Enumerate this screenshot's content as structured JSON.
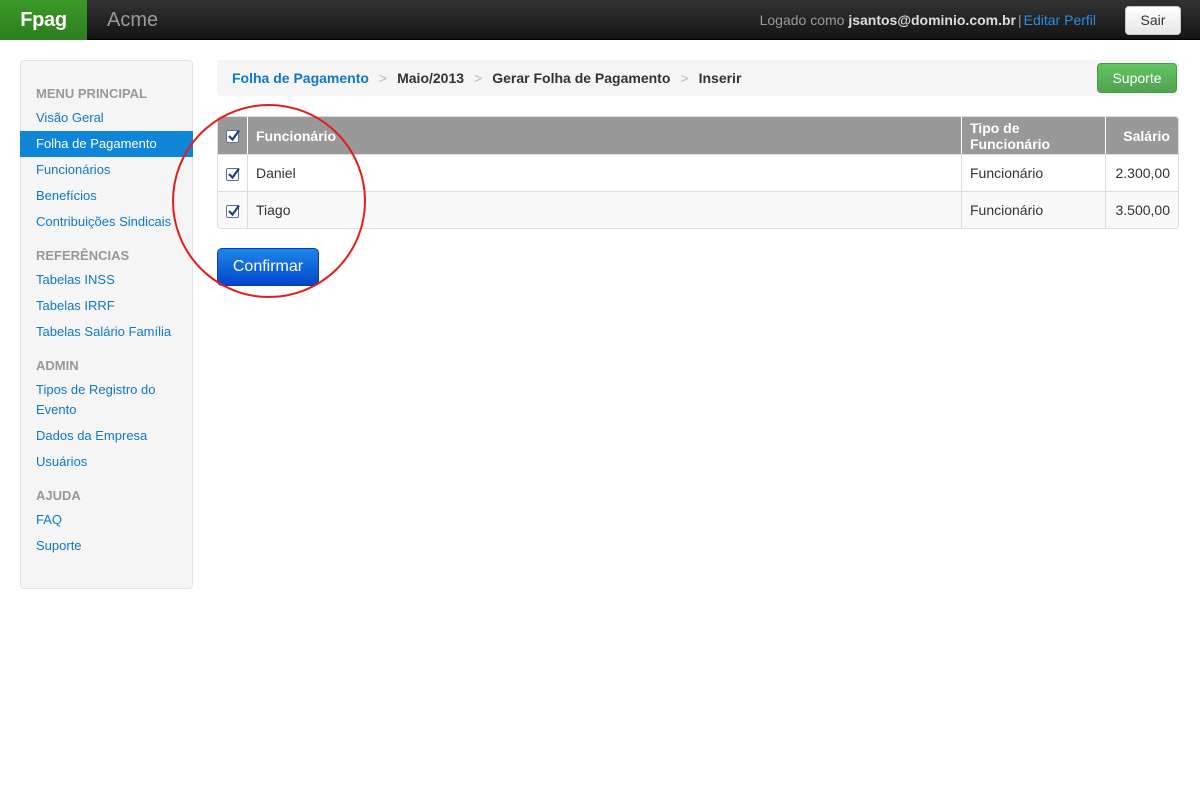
{
  "navbar": {
    "brand": "Fpag",
    "company": "Acme",
    "logged_prefix": "Logado como",
    "user_email": "jsantos@dominio.com.br",
    "separator": "|",
    "edit_profile": "Editar Perfil",
    "logout": "Sair"
  },
  "sidebar": {
    "sections": [
      {
        "header": "MENU PRINCIPAL",
        "items": [
          "Visão Geral",
          "Folha de Pagamento",
          "Funcionários",
          "Benefícios",
          "Contribuições Sindicais"
        ]
      },
      {
        "header": "REFERÊNCIAS",
        "items": [
          "Tabelas INSS",
          "Tabelas IRRF",
          "Tabelas Salário Família"
        ]
      },
      {
        "header": "ADMIN",
        "items": [
          "Tipos de Registro do",
          "Evento",
          "Dados da Empresa",
          "Usuários"
        ]
      },
      {
        "header": "AJUDA",
        "items": [
          "FAQ",
          "Suporte"
        ]
      }
    ],
    "active_item": "Folha de Pagamento"
  },
  "breadcrumb": {
    "items": [
      "Folha de Pagamento",
      "Maio/2013",
      "Gerar Folha de Pagamento",
      "Inserir"
    ],
    "divider": ">"
  },
  "support_button": "Suporte",
  "table": {
    "headers": [
      "Funcionário",
      "Tipo de Funcionário",
      "Salário"
    ],
    "header_checked": true,
    "rows": [
      {
        "checked": true,
        "nome": "Daniel",
        "tipo": "Funcionário",
        "salario": "2.300,00"
      },
      {
        "checked": true,
        "nome": "Tiago",
        "tipo": "Funcionário",
        "salario": "3.500,00"
      }
    ]
  },
  "confirm_button": "Confirmar",
  "colors": {
    "brand_green": "#2d7e1e",
    "link_blue": "#0f78c8",
    "active_blue": "#0f85d8",
    "confirm_blue": "#0047cc",
    "support_green": "#51a351",
    "annotation_red": "#e41c1c",
    "table_header_gray": "#999999"
  }
}
